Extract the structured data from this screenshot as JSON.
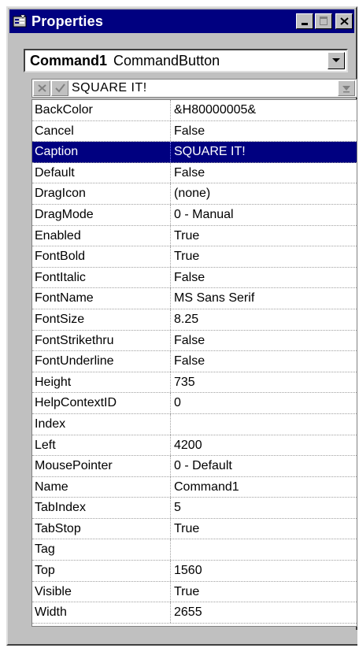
{
  "window": {
    "title": "Properties"
  },
  "object_selector": {
    "object_name": "Command1",
    "object_type": "CommandButton"
  },
  "edit_box": {
    "value": "SQUARE IT!"
  },
  "properties": [
    {
      "name": "BackColor",
      "value": "&H80000005&"
    },
    {
      "name": "Cancel",
      "value": "False"
    },
    {
      "name": "Caption",
      "value": "SQUARE IT!",
      "selected": true
    },
    {
      "name": "Default",
      "value": "False"
    },
    {
      "name": "DragIcon",
      "value": "(none)"
    },
    {
      "name": "DragMode",
      "value": "0 - Manual"
    },
    {
      "name": "Enabled",
      "value": "True"
    },
    {
      "name": "FontBold",
      "value": "True"
    },
    {
      "name": "FontItalic",
      "value": "False"
    },
    {
      "name": "FontName",
      "value": "MS Sans Serif"
    },
    {
      "name": "FontSize",
      "value": "8.25"
    },
    {
      "name": "FontStrikethru",
      "value": "False"
    },
    {
      "name": "FontUnderline",
      "value": "False"
    },
    {
      "name": "Height",
      "value": "735"
    },
    {
      "name": "HelpContextID",
      "value": "0"
    },
    {
      "name": "Index",
      "value": ""
    },
    {
      "name": "Left",
      "value": "4200"
    },
    {
      "name": "MousePointer",
      "value": "0 - Default"
    },
    {
      "name": "Name",
      "value": "Command1"
    },
    {
      "name": "TabIndex",
      "value": "5"
    },
    {
      "name": "TabStop",
      "value": "True"
    },
    {
      "name": "Tag",
      "value": ""
    },
    {
      "name": "Top",
      "value": "1560"
    },
    {
      "name": "Visible",
      "value": "True"
    },
    {
      "name": "Width",
      "value": "2655"
    }
  ],
  "colors": {
    "titlebar": "#000080",
    "selection": "#000080",
    "face": "#c0c0c0"
  }
}
